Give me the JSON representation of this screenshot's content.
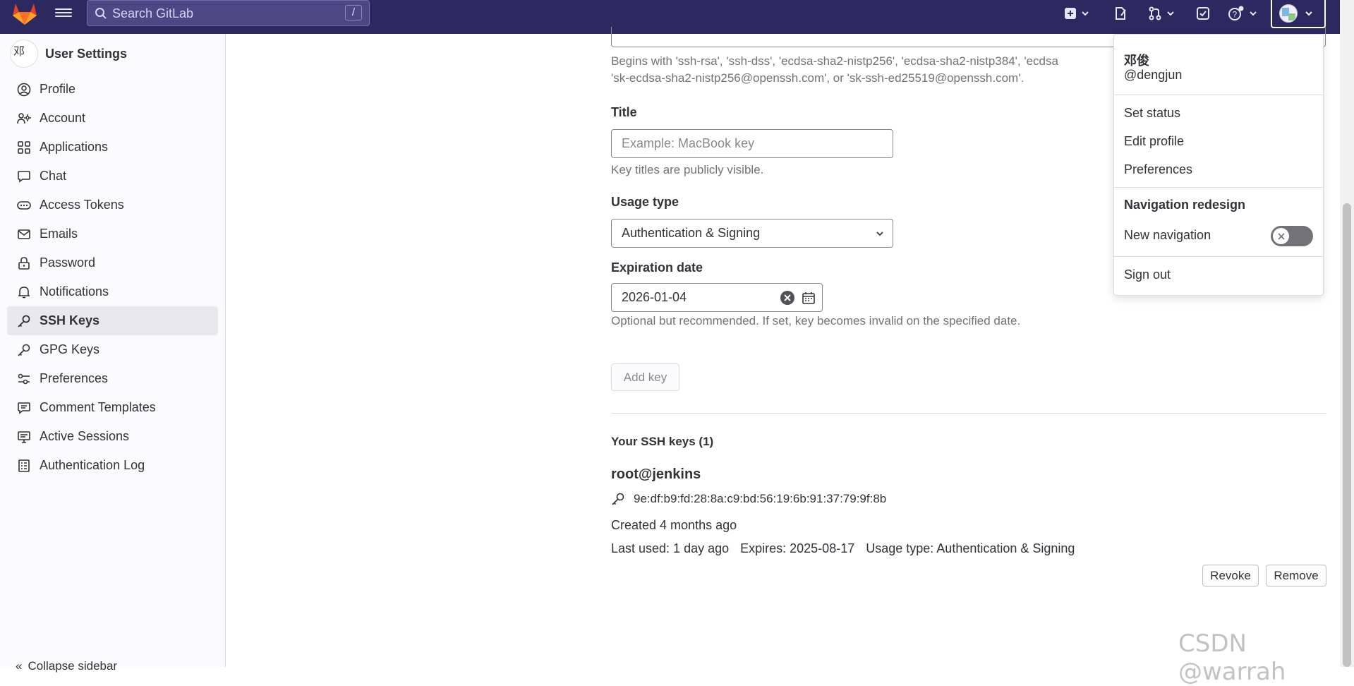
{
  "topbar": {
    "search_placeholder": "Search GitLab",
    "search_shortcut": "/",
    "colors": {
      "bg": "#2b2960",
      "logo": "#e24329"
    }
  },
  "sidebar": {
    "title": "User Settings",
    "avatar_alt": "邓",
    "items": [
      {
        "label": "Profile",
        "icon": "profile-icon"
      },
      {
        "label": "Account",
        "icon": "account-icon"
      },
      {
        "label": "Applications",
        "icon": "applications-icon"
      },
      {
        "label": "Chat",
        "icon": "chat-icon"
      },
      {
        "label": "Access Tokens",
        "icon": "token-icon"
      },
      {
        "label": "Emails",
        "icon": "mail-icon"
      },
      {
        "label": "Password",
        "icon": "lock-icon"
      },
      {
        "label": "Notifications",
        "icon": "bell-icon"
      },
      {
        "label": "SSH Keys",
        "icon": "key-icon",
        "active": true
      },
      {
        "label": "GPG Keys",
        "icon": "key-icon"
      },
      {
        "label": "Preferences",
        "icon": "preferences-icon"
      },
      {
        "label": "Comment Templates",
        "icon": "comment-icon"
      },
      {
        "label": "Active Sessions",
        "icon": "monitor-icon"
      },
      {
        "label": "Authentication Log",
        "icon": "log-icon"
      }
    ],
    "collapse_label": "Collapse sidebar"
  },
  "form": {
    "key_help_line1": "Begins with 'ssh-rsa', 'ssh-dss', 'ecdsa-sha2-nistp256', 'ecdsa-sha2-nistp384', 'ecdsa",
    "key_help_line2": "'sk-ecdsa-sha2-nistp256@openssh.com', or 'sk-ssh-ed25519@openssh.com'.",
    "title_label": "Title",
    "title_placeholder": "Example: MacBook key",
    "title_help": "Key titles are publicly visible.",
    "usage_label": "Usage type",
    "usage_value": "Authentication & Signing",
    "expiration_label": "Expiration date",
    "expiration_value": "2026-01-04",
    "expiration_help": "Optional but recommended. If set, key becomes invalid on the specified date.",
    "add_key_label": "Add key"
  },
  "keys": {
    "heading": "Your SSH keys (1)",
    "items": [
      {
        "title": "root@jenkins",
        "fingerprint": "9e:df:b9:fd:28:8a:c9:bd:56:19:6b:91:37:79:9f:8b",
        "created": "Created 4 months ago",
        "last_used": "Last used: 1 day ago",
        "expires": "Expires: 2025-08-17",
        "usage": "Usage type: Authentication & Signing",
        "revoke_label": "Revoke",
        "remove_label": "Remove"
      }
    ]
  },
  "user_menu": {
    "name": "邓俊",
    "username": "@dengjun",
    "set_status": "Set status",
    "edit_profile": "Edit profile",
    "preferences": "Preferences",
    "nav_redesign_heading": "Navigation redesign",
    "new_navigation": "New navigation",
    "new_navigation_on": false,
    "sign_out": "Sign out"
  },
  "watermark": "CSDN @warrah"
}
